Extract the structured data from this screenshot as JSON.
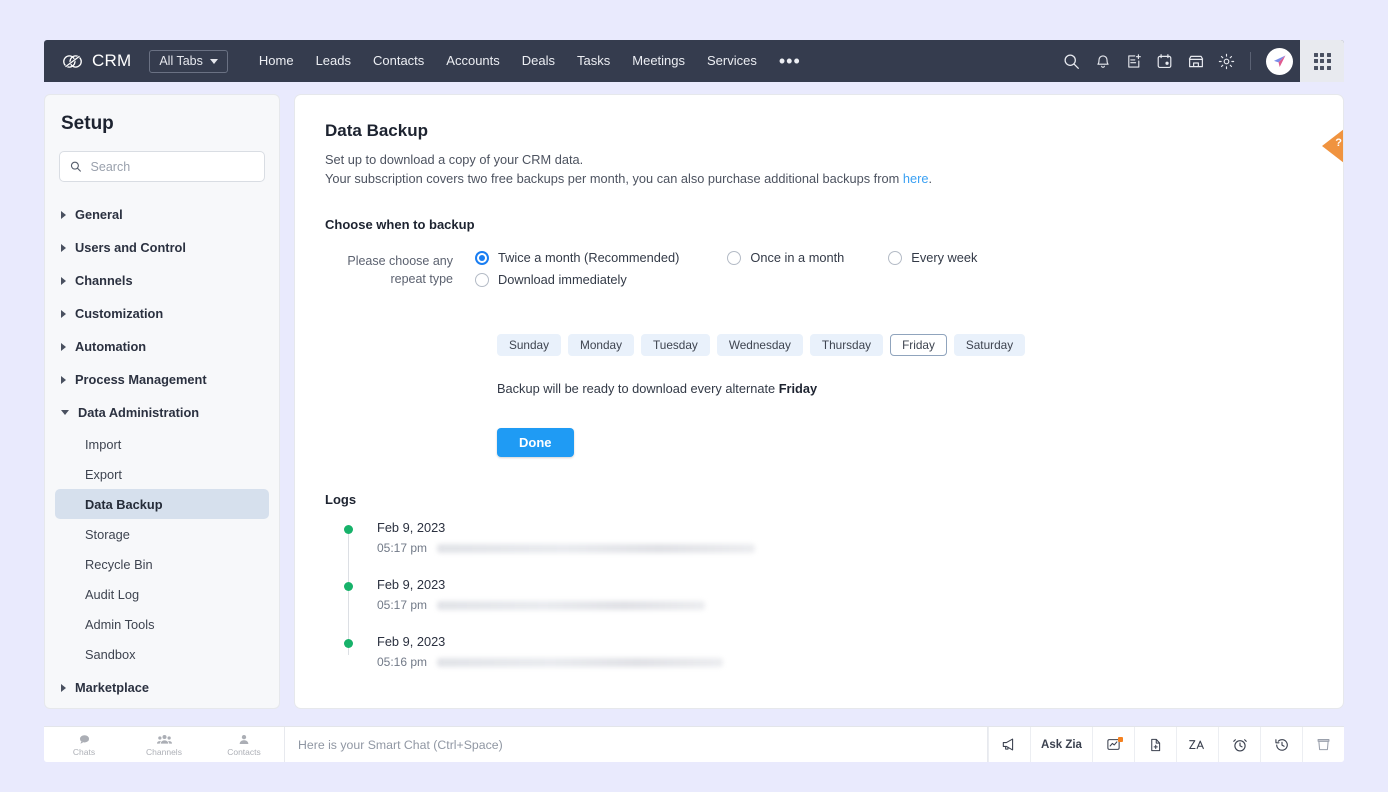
{
  "topnav": {
    "brand": "CRM",
    "all_tabs_label": "All Tabs",
    "items": [
      {
        "label": "Home"
      },
      {
        "label": "Leads"
      },
      {
        "label": "Contacts"
      },
      {
        "label": "Accounts"
      },
      {
        "label": "Deals"
      },
      {
        "label": "Tasks"
      },
      {
        "label": "Meetings"
      },
      {
        "label": "Services"
      }
    ],
    "more_label": "•••",
    "icons": [
      "search-icon",
      "bell-icon",
      "note-add-icon",
      "calendar-icon",
      "marketplace-icon",
      "gear-icon"
    ]
  },
  "sidebar": {
    "title": "Setup",
    "search_placeholder": "Search",
    "search_value": "",
    "groups": [
      {
        "label": "General",
        "expanded": false
      },
      {
        "label": "Users and Control",
        "expanded": false
      },
      {
        "label": "Channels",
        "expanded": false
      },
      {
        "label": "Customization",
        "expanded": false
      },
      {
        "label": "Automation",
        "expanded": false
      },
      {
        "label": "Process Management",
        "expanded": false
      },
      {
        "label": "Data Administration",
        "expanded": true
      },
      {
        "label": "Marketplace",
        "expanded": false
      }
    ],
    "data_admin_items": [
      {
        "label": "Import",
        "active": false
      },
      {
        "label": "Export",
        "active": false
      },
      {
        "label": "Data Backup",
        "active": true
      },
      {
        "label": "Storage",
        "active": false
      },
      {
        "label": "Recycle Bin",
        "active": false
      },
      {
        "label": "Audit Log",
        "active": false
      },
      {
        "label": "Admin Tools",
        "active": false
      },
      {
        "label": "Sandbox",
        "active": false
      }
    ]
  },
  "main": {
    "title": "Data Backup",
    "desc_line1": "Set up to download a copy of your CRM data.",
    "desc_line2_pre": "Your subscription covers two free backups per month, you can also purchase additional backups from ",
    "desc_link": "here",
    "desc_line2_post": ".",
    "section_heading": "Choose when to backup",
    "field_label_line1": "Please choose any",
    "field_label_line2": "repeat type",
    "repeat_options": [
      {
        "label": "Twice a month (Recommended)",
        "selected": true
      },
      {
        "label": "Once in a month",
        "selected": false
      },
      {
        "label": "Every week",
        "selected": false
      },
      {
        "label": "Download immediately",
        "selected": false
      }
    ],
    "days": [
      {
        "label": "Sunday",
        "selected": false
      },
      {
        "label": "Monday",
        "selected": false
      },
      {
        "label": "Tuesday",
        "selected": false
      },
      {
        "label": "Wednesday",
        "selected": false
      },
      {
        "label": "Thursday",
        "selected": false
      },
      {
        "label": "Friday",
        "selected": true
      },
      {
        "label": "Saturday",
        "selected": false
      }
    ],
    "ready_note_pre": "Backup will be ready to download every alternate ",
    "ready_note_day": "Friday",
    "done_label": "Done",
    "logs_heading": "Logs",
    "logs": [
      {
        "date": "Feb 9, 2023",
        "time": "05:17 pm",
        "message_width": 318
      },
      {
        "date": "Feb 9, 2023",
        "time": "05:17 pm",
        "message_width": 268
      },
      {
        "date": "Feb 9, 2023",
        "time": "05:16 pm",
        "message_width": 286
      }
    ],
    "help_badge": "?"
  },
  "bottombar": {
    "tabs": [
      {
        "label": "Chats",
        "icon": "chat-icon"
      },
      {
        "label": "Channels",
        "icon": "channels-icon"
      },
      {
        "label": "Contacts",
        "icon": "contacts-icon"
      }
    ],
    "chat_placeholder": "Here is your Smart Chat (Ctrl+Space)",
    "ask_zia_label": "Ask Zia",
    "right_icons": [
      "announcement-icon",
      "analytics-icon",
      "tag-icon",
      "zia-translate-icon",
      "reminder-icon",
      "recent-history-icon",
      "trash-icon"
    ]
  },
  "colors": {
    "page_background": "#e9eafd",
    "nav_background": "#353c4e",
    "accent_blue": "#1f9bf4",
    "radio_blue": "#1a7ef2",
    "log_dot_green": "#17b26a",
    "help_orange": "#f0933f",
    "sidebar_active": "#d6e0ed",
    "chip_blue": "#e9f1fb"
  }
}
